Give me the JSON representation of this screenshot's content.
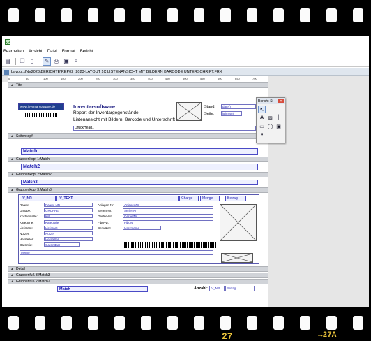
{
  "film": {
    "frame_number": "27",
    "frame_label": "→27A"
  },
  "menu": [
    "Bearbeiten",
    "Ansicht",
    "Datei",
    "Format",
    "Bericht"
  ],
  "toolbar": [
    "save-icon",
    "copy-icon",
    "page-icon",
    "design-icon",
    "print-icon",
    "preview-icon",
    "align-icon"
  ],
  "document": {
    "title": "Layout:\\INV2023\\BERICHTE\\REP02_2023-LAYOUT 1C LISTENANSICHT MIT BILDERN  BARCODE UNTERSCHRIFT.FRX",
    "ruler_ticks": [
      "0",
      "50",
      "100",
      "150",
      "200",
      "250",
      "300",
      "350",
      "400",
      "450",
      "500",
      "550",
      "600",
      "650",
      "700"
    ]
  },
  "bands": {
    "title": "Titel",
    "page_header": "Seitenkopf",
    "group1_header": "Gruppenkopf 1:Match",
    "group2_header": "Gruppenkopf 2:Match2",
    "group3_header": "Gruppenkopf 3:Match3",
    "detail": "Detail",
    "group3_footer": "Gruppenfuß 3:Match3",
    "group2_footer": "Gruppenfuß 2:Match2"
  },
  "title_band": {
    "logo_url": "www.inventarsoftware.de",
    "heading": "Inventarsoftware",
    "line1": "Report der Inventargegenstände",
    "line2": "Listenansicht mit Bildern, Barcode und Unterschrift",
    "druckhead": "DruckHead1",
    "stand_label": "Stand:",
    "stand_value": "date()",
    "seite_label": "Seite:",
    "seite_value": "ltrim(str(_"
  },
  "groups": {
    "match": "Match",
    "match2": "Match2",
    "match3": "Match3"
  },
  "group3": {
    "iv_nr": "IV_NR",
    "iv_text": "IV_TEXT",
    "charge": "Charge",
    "menge": "Menge",
    "betrag": "Betrag",
    "labels_left": [
      "Raum:",
      "Gruppe:",
      "Kostenstelle:",
      "Kategorie:",
      "Lieferant:",
      "Nutzer:",
      "Hersteller:",
      "Garantie:"
    ],
    "fields_left": [
      "Raum_NR",
      "GRUPPE",
      "Kst",
      "Kategorie",
      "Lieferant",
      "Nutzer",
      "Hersteller",
      "GarantDat"
    ],
    "labels_mid": [
      "Anlagen-Nr:",
      "Serien-Nr:",
      "Geräte-Nr:",
      "Fibu-Nr:",
      "Benutzer:"
    ],
    "fields_mid": [
      "AnlagenNr",
      "SerienNr",
      "GeraetNr",
      "FibuNr",
      "Usermame"
    ],
    "memo": "Memo"
  },
  "footer": {
    "match": "Match",
    "anzahl_label": "Anzahl:",
    "anzahl_value": "IV_NR",
    "betrag_value": "Betrag"
  },
  "palette": {
    "title": "Bericht-St",
    "tools": [
      "pointer-icon",
      "text-icon",
      "image-icon",
      "line-icon",
      "rectangle-icon",
      "ellipse-icon",
      "picture-icon",
      "lock-icon"
    ]
  }
}
